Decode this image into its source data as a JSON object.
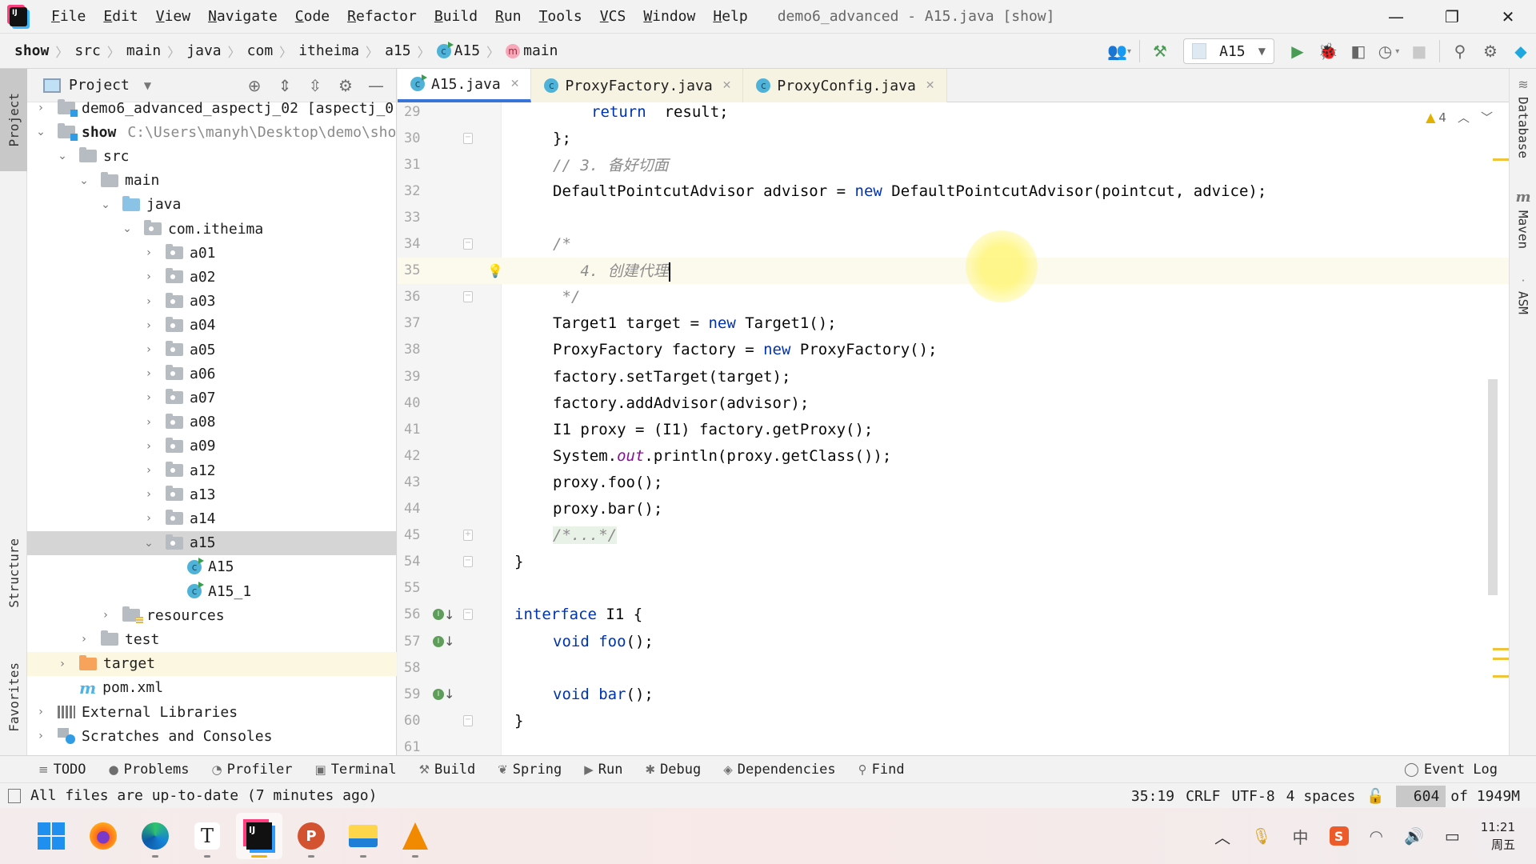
{
  "titlebar": {
    "logo_text": "IJ",
    "menu": [
      "File",
      "Edit",
      "View",
      "Navigate",
      "Code",
      "Refactor",
      "Build",
      "Run",
      "Tools",
      "VCS",
      "Window",
      "Help"
    ],
    "window_title": "demo6_advanced - A15.java [show]",
    "controls": {
      "minimize": "—",
      "restore": "❐",
      "close": "✕"
    }
  },
  "navbar": {
    "breadcrumbs": [
      "show",
      "src",
      "main",
      "java",
      "com",
      "itheima",
      "a15",
      "A15",
      "main"
    ],
    "run_config": "A15",
    "icons": [
      "user-icon",
      "build-hammer-icon",
      "run-icon",
      "debug-icon",
      "coverage-icon",
      "profile-icon",
      "stop-icon",
      "search-icon",
      "settings-icon",
      "toolbox-icon"
    ]
  },
  "left_stripe": {
    "tabs": [
      "Project",
      "Structure",
      "Favorites"
    ]
  },
  "project": {
    "title": "Project",
    "tree": [
      {
        "label": "demo6_advanced_aspectj_02 [aspectj_0",
        "depth": 0,
        "type": "module",
        "expand": "›",
        "bold": false,
        "partial": true
      },
      {
        "label": "show",
        "path": "C:\\Users\\manyh\\Desktop\\demo\\sho",
        "depth": 0,
        "type": "module",
        "expand": "⌄",
        "bold": true
      },
      {
        "label": "src",
        "depth": 1,
        "type": "folder",
        "expand": "⌄"
      },
      {
        "label": "main",
        "depth": 2,
        "type": "folder",
        "expand": "⌄"
      },
      {
        "label": "java",
        "depth": 3,
        "type": "src-root",
        "expand": "⌄"
      },
      {
        "label": "com.itheima",
        "depth": 4,
        "type": "pkg",
        "expand": "⌄"
      },
      {
        "label": "a01",
        "depth": 5,
        "type": "pkg",
        "expand": "›"
      },
      {
        "label": "a02",
        "depth": 5,
        "type": "pkg",
        "expand": "›"
      },
      {
        "label": "a03",
        "depth": 5,
        "type": "pkg",
        "expand": "›"
      },
      {
        "label": "a04",
        "depth": 5,
        "type": "pkg",
        "expand": "›"
      },
      {
        "label": "a05",
        "depth": 5,
        "type": "pkg",
        "expand": "›"
      },
      {
        "label": "a06",
        "depth": 5,
        "type": "pkg",
        "expand": "›"
      },
      {
        "label": "a07",
        "depth": 5,
        "type": "pkg",
        "expand": "›"
      },
      {
        "label": "a08",
        "depth": 5,
        "type": "pkg",
        "expand": "›"
      },
      {
        "label": "a09",
        "depth": 5,
        "type": "pkg",
        "expand": "›"
      },
      {
        "label": "a12",
        "depth": 5,
        "type": "pkg",
        "expand": "›"
      },
      {
        "label": "a13",
        "depth": 5,
        "type": "pkg",
        "expand": "›"
      },
      {
        "label": "a14",
        "depth": 5,
        "type": "pkg",
        "expand": "›"
      },
      {
        "label": "a15",
        "depth": 5,
        "type": "pkg",
        "expand": "⌄",
        "selected": true
      },
      {
        "label": "A15",
        "depth": 6,
        "type": "class",
        "expand": ""
      },
      {
        "label": "A15_1",
        "depth": 6,
        "type": "class",
        "expand": ""
      },
      {
        "label": "resources",
        "depth": 3,
        "type": "res",
        "expand": "›"
      },
      {
        "label": "test",
        "depth": 2,
        "type": "folder",
        "expand": "›"
      },
      {
        "label": "target",
        "depth": 1,
        "type": "target",
        "expand": "›",
        "highlight": true
      },
      {
        "label": "pom.xml",
        "depth": 1,
        "type": "pom",
        "expand": ""
      },
      {
        "label": "External Libraries",
        "depth": 0,
        "type": "lib",
        "expand": "›"
      },
      {
        "label": "Scratches and Consoles",
        "depth": 0,
        "type": "scratch",
        "expand": "›"
      }
    ]
  },
  "editor": {
    "tabs": [
      {
        "label": "A15.java",
        "active": true
      },
      {
        "label": "ProxyFactory.java",
        "active": false
      },
      {
        "label": "ProxyConfig.java",
        "active": false
      }
    ],
    "warning_count": "4",
    "current_line": 35,
    "lines": [
      {
        "n": "29",
        "indent": 2,
        "tokens": [
          [
            "kw",
            "return"
          ],
          [
            "",
            "  result;"
          ]
        ]
      },
      {
        "n": "30",
        "indent": 1,
        "fold": "⊟",
        "tokens": [
          [
            "",
            "};"
          ]
        ]
      },
      {
        "n": "31",
        "indent": 1,
        "tokens": [
          [
            "cm",
            "// 3. 备好切面"
          ]
        ]
      },
      {
        "n": "32",
        "indent": 1,
        "tokens": [
          [
            "",
            "DefaultPointcutAdvisor advisor = "
          ],
          [
            "kw",
            "new"
          ],
          [
            "",
            " DefaultPointcutAdvisor(pointcut, advice);"
          ]
        ]
      },
      {
        "n": "33",
        "indent": 1,
        "tokens": []
      },
      {
        "n": "34",
        "indent": 1,
        "fold": "⊟",
        "tokens": [
          [
            "cm",
            "/*"
          ]
        ]
      },
      {
        "n": "35",
        "indent": 1,
        "bulb": true,
        "caret": true,
        "tokens": [
          [
            "cm",
            "   4. 创建代理"
          ]
        ]
      },
      {
        "n": "36",
        "indent": 1,
        "fold": "⊟",
        "tokens": [
          [
            "cm",
            " */"
          ]
        ]
      },
      {
        "n": "37",
        "indent": 1,
        "tokens": [
          [
            "",
            "Target1 target = "
          ],
          [
            "kw",
            "new"
          ],
          [
            "",
            " Target1();"
          ]
        ]
      },
      {
        "n": "38",
        "indent": 1,
        "tokens": [
          [
            "",
            "ProxyFactory factory = "
          ],
          [
            "kw",
            "new"
          ],
          [
            "",
            " ProxyFactory();"
          ]
        ]
      },
      {
        "n": "39",
        "indent": 1,
        "tokens": [
          [
            "",
            "factory.setTarget(target);"
          ]
        ]
      },
      {
        "n": "40",
        "indent": 1,
        "tokens": [
          [
            "",
            "factory.addAdvisor(advisor);"
          ]
        ]
      },
      {
        "n": "41",
        "indent": 1,
        "tokens": [
          [
            "",
            "I1 proxy = (I1) factory.getProxy();"
          ]
        ]
      },
      {
        "n": "42",
        "indent": 1,
        "tokens": [
          [
            "",
            "System."
          ],
          [
            "st",
            "out"
          ],
          [
            "",
            ".println(proxy.getClass());"
          ]
        ]
      },
      {
        "n": "43",
        "indent": 1,
        "tokens": [
          [
            "",
            "proxy.foo();"
          ]
        ]
      },
      {
        "n": "44",
        "indent": 1,
        "tokens": [
          [
            "",
            "proxy.bar();"
          ]
        ]
      },
      {
        "n": "45",
        "indent": 1,
        "fold": "⊞",
        "tokens": [
          [
            "cm fold-region",
            "/*...*/"
          ]
        ]
      },
      {
        "n": "54",
        "indent": 0,
        "fold": "⊟",
        "tokens": [
          [
            "",
            "}"
          ]
        ]
      },
      {
        "n": "55",
        "indent": 0,
        "tokens": []
      },
      {
        "n": "56",
        "indent": 0,
        "impl": true,
        "fold": "⊟",
        "tokens": [
          [
            "kw",
            "interface"
          ],
          [
            "",
            " I1 {"
          ]
        ]
      },
      {
        "n": "57",
        "indent": 1,
        "impl": true,
        "tokens": [
          [
            "kw",
            "void foo"
          ],
          [
            "",
            "();"
          ]
        ]
      },
      {
        "n": "58",
        "indent": 1,
        "tokens": []
      },
      {
        "n": "59",
        "indent": 1,
        "impl": true,
        "tokens": [
          [
            "kw",
            "void bar"
          ],
          [
            "",
            "();"
          ]
        ]
      },
      {
        "n": "60",
        "indent": 0,
        "fold": "⊟",
        "tokens": [
          [
            "",
            "}"
          ]
        ]
      },
      {
        "n": "61",
        "indent": 0,
        "tokens": []
      }
    ]
  },
  "right_stripe": {
    "tabs": [
      "Database",
      "Maven",
      "ASM"
    ]
  },
  "bottom_tools": [
    {
      "label": "TODO",
      "icon": "≡"
    },
    {
      "label": "Problems",
      "icon": "●"
    },
    {
      "label": "Profiler",
      "icon": "◔"
    },
    {
      "label": "Terminal",
      "icon": "▣"
    },
    {
      "label": "Build",
      "icon": "⚒"
    },
    {
      "label": "Spring",
      "icon": "❦"
    },
    {
      "label": "Run",
      "icon": "▶"
    },
    {
      "label": "Debug",
      "icon": "✱"
    },
    {
      "label": "Dependencies",
      "icon": "◈"
    },
    {
      "label": "Find",
      "icon": "⚲"
    }
  ],
  "event_log": "Event Log",
  "status": {
    "message": "All files are up-to-date (7 minutes ago)",
    "position": "35:19",
    "line_sep": "CRLF",
    "encoding": "UTF-8",
    "indent": "4 spaces",
    "memory_used": "604",
    "memory_total": "of 1949M"
  },
  "taskbar": {
    "apps": [
      "start",
      "firefox",
      "edge",
      "typora",
      "intellij-idea",
      "powerpoint",
      "file-explorer",
      "vlc"
    ],
    "active_app": "intellij-idea",
    "tray": {
      "ime": "中",
      "time": "11:21",
      "day": "周五"
    }
  }
}
